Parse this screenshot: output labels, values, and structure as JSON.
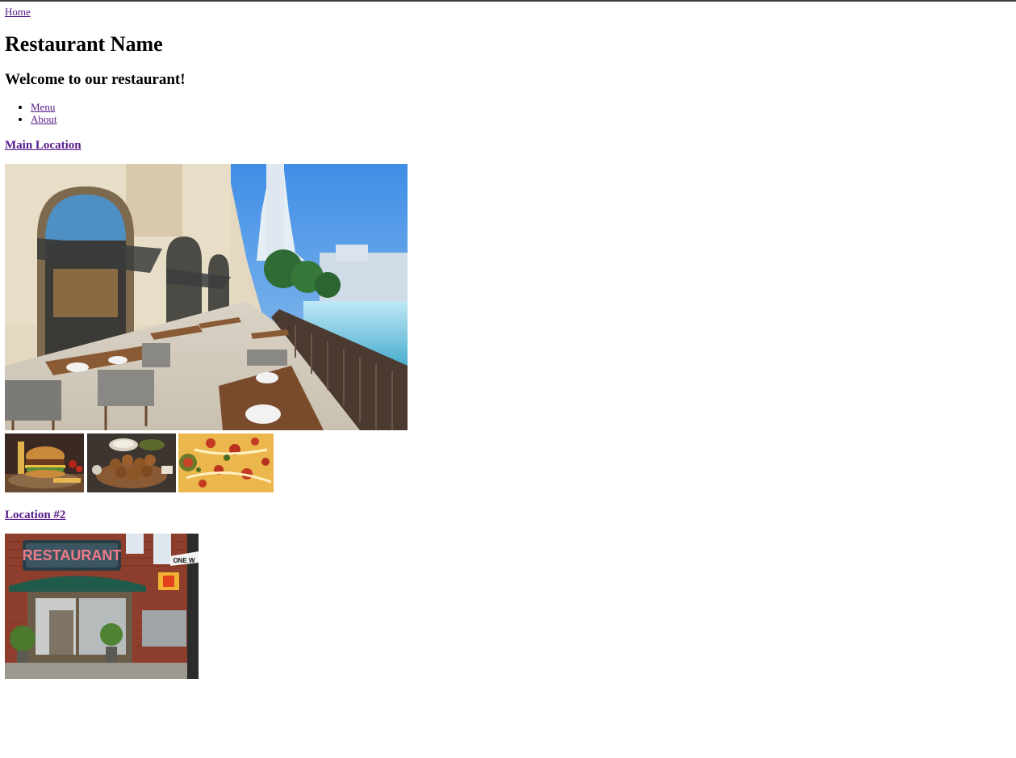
{
  "nav": {
    "home_label": "Home",
    "items": [
      {
        "label": "Menu"
      },
      {
        "label": "About"
      }
    ]
  },
  "header": {
    "title": "Restaurant Name",
    "subtitle": "Welcome to our restaurant!"
  },
  "locations": [
    {
      "name": "Main Location",
      "photo": "outdoor-terrace-photo",
      "thumbnails": [
        "burger-photo",
        "falafel-photo",
        "pizza-photo"
      ]
    },
    {
      "name": "Location #2",
      "photo": "storefront-photo",
      "sign_text": "RESTAURANT",
      "street_sign_text": "ONE W"
    }
  ],
  "colors": {
    "link": "#551a8b",
    "topbar": "#3c3c3c"
  }
}
